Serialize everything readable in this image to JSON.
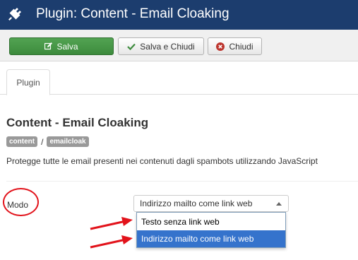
{
  "header": {
    "title": "Plugin: Content - Email Cloaking",
    "icon": "plug-icon"
  },
  "toolbar": {
    "save_label": "Salva",
    "save_close_label": "Salva e Chiudi",
    "close_label": "Chiudi"
  },
  "tabs": [
    {
      "label": "Plugin",
      "active": true
    }
  ],
  "plugin": {
    "title": "Content - Email Cloaking",
    "badges": [
      "content",
      "emailcloak"
    ],
    "separator": "/",
    "description": "Protegge tutte le email presenti nei contenuti dagli spambots utilizzando JavaScript"
  },
  "form": {
    "modo_label": "Modo",
    "selected": "Indirizzo mailto come link web",
    "options": [
      "Testo senza link web",
      "Indirizzo mailto come link web"
    ]
  },
  "colors": {
    "header_bg": "#1c3d6e",
    "save_green": "#3d8b3d",
    "highlight": "#3573cc",
    "annotation_red": "#e2131b"
  }
}
